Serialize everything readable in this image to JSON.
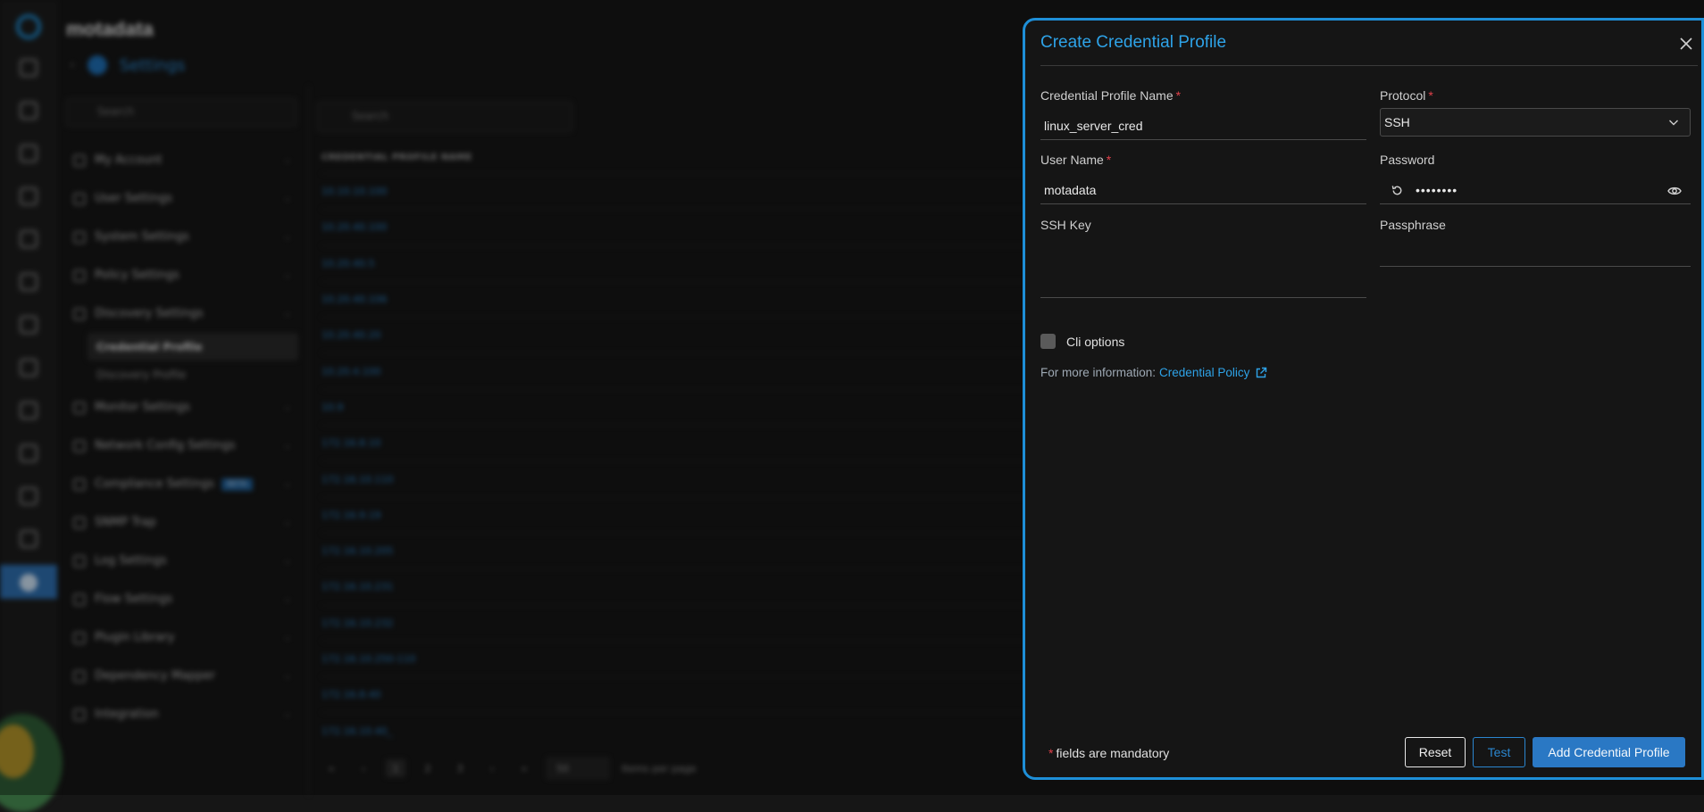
{
  "app": {
    "brand": "motadata",
    "page_title": "Settings",
    "side_search_placeholder": "Search",
    "side_menu": [
      {
        "label": "My Account"
      },
      {
        "label": "User Settings"
      },
      {
        "label": "System Settings"
      },
      {
        "label": "Policy Settings"
      },
      {
        "label": "Discovery Settings"
      },
      {
        "label": "Monitor Settings"
      },
      {
        "label": "Network Config Settings"
      },
      {
        "label": "Compliance Settings",
        "badge": "BETA"
      },
      {
        "label": "SNMP Trap"
      },
      {
        "label": "Log Settings"
      },
      {
        "label": "Flow Settings"
      },
      {
        "label": "Plugin Library"
      },
      {
        "label": "Dependency Mapper"
      },
      {
        "label": "Integration"
      }
    ],
    "discovery_sub": [
      "Credential Profile",
      "Discovery Profile"
    ],
    "list_search_placeholder": "Search",
    "column_header": "CREDENTIAL PROFILE NAME",
    "rows": [
      "10.10.10.100",
      "10.20.40.100",
      "10.20.40.5",
      "10.20.40.106",
      "10.20.40.20",
      "10.20.4.100",
      "10.9",
      "172.16.8.10",
      "172.16.10.110",
      "172.16.9.19",
      "172.16.10.205",
      "172.16.10.231",
      "172.16.10.232",
      "172.16.10.250-110",
      "172.16.8.40",
      "172.16.10.40_"
    ],
    "pager": {
      "pages": [
        "1",
        "2",
        "3"
      ],
      "page_size": "50",
      "per_page_label": "Items per page"
    }
  },
  "drawer": {
    "title": "Create Credential Profile",
    "fields": {
      "profile_name": {
        "label": "Credential Profile Name",
        "value": "linux_server_cred"
      },
      "protocol": {
        "label": "Protocol",
        "value": "SSH"
      },
      "user_name": {
        "label": "User Name",
        "value": "motadata"
      },
      "password": {
        "label": "Password",
        "value": "••••••••"
      },
      "ssh_key": {
        "label": "SSH Key",
        "value": ""
      },
      "passphrase": {
        "label": "Passphrase",
        "value": ""
      }
    },
    "required_mark": "*",
    "cli_options_label": "Cli options",
    "info_prefix": "For more information:",
    "info_link": "Credential Policy",
    "mandatory_note": "fields are mandatory",
    "buttons": {
      "reset": "Reset",
      "test": "Test",
      "add": "Add Credential Profile"
    }
  },
  "colors": {
    "accent": "#2ea3e8",
    "primary_button": "#2a78c4",
    "required": "#e0414a"
  }
}
